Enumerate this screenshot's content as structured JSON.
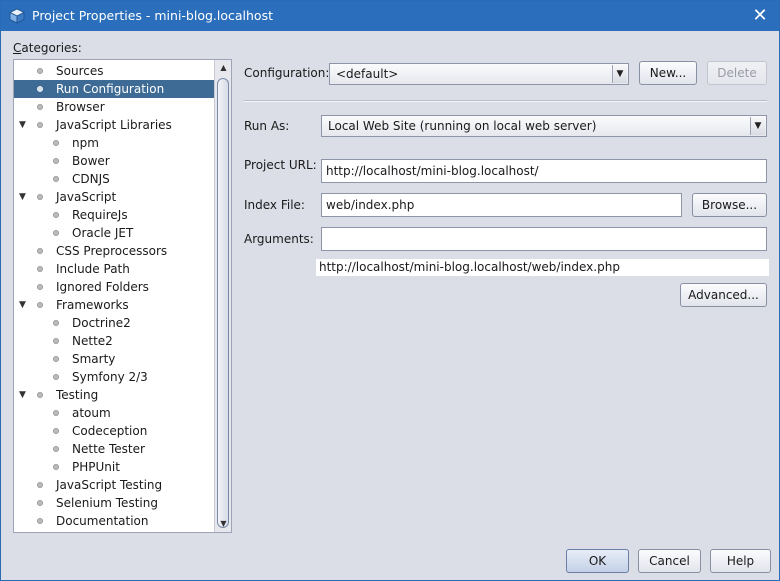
{
  "window": {
    "title": "Project Properties - mini-blog.localhost"
  },
  "categories": {
    "label": "Categories:",
    "items": [
      {
        "label": "Sources",
        "level": 0,
        "expandable": false,
        "selected": false
      },
      {
        "label": "Run Configuration",
        "level": 0,
        "expandable": false,
        "selected": true
      },
      {
        "label": "Browser",
        "level": 0,
        "expandable": false,
        "selected": false
      },
      {
        "label": "JavaScript Libraries",
        "level": 0,
        "expandable": true,
        "selected": false
      },
      {
        "label": "npm",
        "level": 1,
        "expandable": false,
        "selected": false
      },
      {
        "label": "Bower",
        "level": 1,
        "expandable": false,
        "selected": false
      },
      {
        "label": "CDNJS",
        "level": 1,
        "expandable": false,
        "selected": false
      },
      {
        "label": "JavaScript",
        "level": 0,
        "expandable": true,
        "selected": false
      },
      {
        "label": "RequireJs",
        "level": 1,
        "expandable": false,
        "selected": false
      },
      {
        "label": "Oracle JET",
        "level": 1,
        "expandable": false,
        "selected": false
      },
      {
        "label": "CSS Preprocessors",
        "level": 0,
        "expandable": false,
        "selected": false
      },
      {
        "label": "Include Path",
        "level": 0,
        "expandable": false,
        "selected": false
      },
      {
        "label": "Ignored Folders",
        "level": 0,
        "expandable": false,
        "selected": false
      },
      {
        "label": "Frameworks",
        "level": 0,
        "expandable": true,
        "selected": false
      },
      {
        "label": "Doctrine2",
        "level": 1,
        "expandable": false,
        "selected": false
      },
      {
        "label": "Nette2",
        "level": 1,
        "expandable": false,
        "selected": false
      },
      {
        "label": "Smarty",
        "level": 1,
        "expandable": false,
        "selected": false
      },
      {
        "label": "Symfony 2/3",
        "level": 1,
        "expandable": false,
        "selected": false
      },
      {
        "label": "Testing",
        "level": 0,
        "expandable": true,
        "selected": false
      },
      {
        "label": "atoum",
        "level": 1,
        "expandable": false,
        "selected": false
      },
      {
        "label": "Codeception",
        "level": 1,
        "expandable": false,
        "selected": false
      },
      {
        "label": "Nette Tester",
        "level": 1,
        "expandable": false,
        "selected": false
      },
      {
        "label": "PHPUnit",
        "level": 1,
        "expandable": false,
        "selected": false
      },
      {
        "label": "JavaScript Testing",
        "level": 0,
        "expandable": false,
        "selected": false
      },
      {
        "label": "Selenium Testing",
        "level": 0,
        "expandable": false,
        "selected": false
      },
      {
        "label": "Documentation",
        "level": 0,
        "expandable": false,
        "selected": false
      }
    ]
  },
  "config": {
    "configuration_label": "Configuration:",
    "configuration_value": "<default>",
    "new_label": "New...",
    "delete_label": "Delete",
    "run_as_label": "Run As:",
    "run_as_value": "Local Web Site (running on local web server)",
    "project_url_label": "Project URL:",
    "project_url_value": "http://localhost/mini-blog.localhost/",
    "index_file_label": "Index File:",
    "index_file_value": "web/index.php",
    "browse_label": "Browse...",
    "arguments_label": "Arguments:",
    "arguments_value": "",
    "resolved_url": "http://localhost/mini-blog.localhost/web/index.php",
    "advanced_label": "Advanced..."
  },
  "footer": {
    "ok_label": "OK",
    "cancel_label": "Cancel",
    "help_label": "Help"
  },
  "colors": {
    "titlebar": "#2b6fbc",
    "selection": "#3e6a96",
    "dialog_bg": "#dbdde7"
  }
}
